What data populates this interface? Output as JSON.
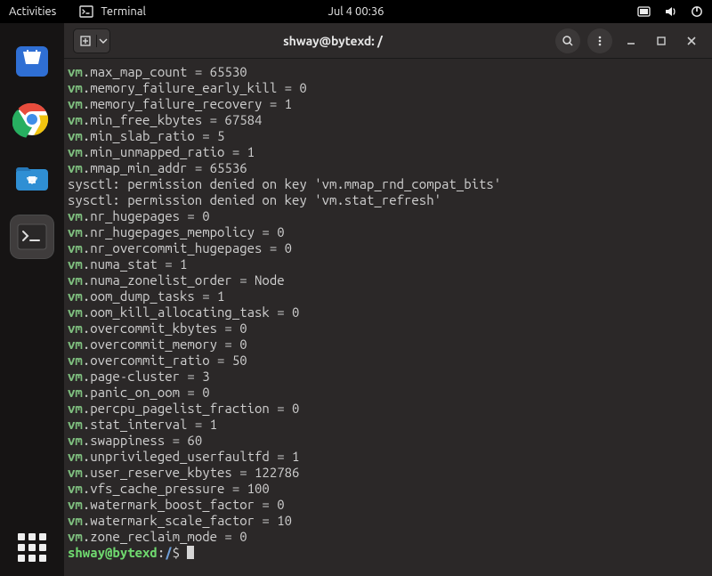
{
  "topbar": {
    "activities": "Activities",
    "app_label": "Terminal",
    "datetime": "Jul 4  00:36"
  },
  "titlebar": {
    "title": "shway@bytexd: /"
  },
  "dock": {
    "items": [
      {
        "name": "software-center"
      },
      {
        "name": "chrome"
      },
      {
        "name": "files"
      },
      {
        "name": "terminal"
      }
    ]
  },
  "terminal": {
    "lines": [
      {
        "prefix": "vm",
        "rest": ".max_map_count = 65530"
      },
      {
        "prefix": "vm",
        "rest": ".memory_failure_early_kill = 0"
      },
      {
        "prefix": "vm",
        "rest": ".memory_failure_recovery = 1"
      },
      {
        "prefix": "vm",
        "rest": ".min_free_kbytes = 67584"
      },
      {
        "prefix": "vm",
        "rest": ".min_slab_ratio = 5"
      },
      {
        "prefix": "vm",
        "rest": ".min_unmapped_ratio = 1"
      },
      {
        "prefix": "vm",
        "rest": ".mmap_min_addr = 65536"
      },
      {
        "err": "sysctl: permission denied on key 'vm.mmap_rnd_compat_bits'"
      },
      {
        "err": "sysctl: permission denied on key 'vm.stat_refresh'"
      },
      {
        "prefix": "vm",
        "rest": ".nr_hugepages = 0"
      },
      {
        "prefix": "vm",
        "rest": ".nr_hugepages_mempolicy = 0"
      },
      {
        "prefix": "vm",
        "rest": ".nr_overcommit_hugepages = 0"
      },
      {
        "prefix": "vm",
        "rest": ".numa_stat = 1"
      },
      {
        "prefix": "vm",
        "rest": ".numa_zonelist_order = Node"
      },
      {
        "prefix": "vm",
        "rest": ".oom_dump_tasks = 1"
      },
      {
        "prefix": "vm",
        "rest": ".oom_kill_allocating_task = 0"
      },
      {
        "prefix": "vm",
        "rest": ".overcommit_kbytes = 0"
      },
      {
        "prefix": "vm",
        "rest": ".overcommit_memory = 0"
      },
      {
        "prefix": "vm",
        "rest": ".overcommit_ratio = 50"
      },
      {
        "prefix": "vm",
        "rest": ".page-cluster = 3"
      },
      {
        "prefix": "vm",
        "rest": ".panic_on_oom = 0"
      },
      {
        "prefix": "vm",
        "rest": ".percpu_pagelist_fraction = 0"
      },
      {
        "prefix": "vm",
        "rest": ".stat_interval = 1"
      },
      {
        "prefix": "vm",
        "rest": ".swappiness = 60"
      },
      {
        "prefix": "vm",
        "rest": ".unprivileged_userfaultfd = 1"
      },
      {
        "prefix": "vm",
        "rest": ".user_reserve_kbytes = 122786"
      },
      {
        "prefix": "vm",
        "rest": ".vfs_cache_pressure = 100"
      },
      {
        "prefix": "vm",
        "rest": ".watermark_boost_factor = 0"
      },
      {
        "prefix": "vm",
        "rest": ".watermark_scale_factor = 10"
      },
      {
        "prefix": "vm",
        "rest": ".zone_reclaim_mode = 0"
      }
    ],
    "prompt": {
      "userhost": "shway@bytexd",
      "sep": ":",
      "path": "/",
      "suffix": "$ "
    }
  }
}
